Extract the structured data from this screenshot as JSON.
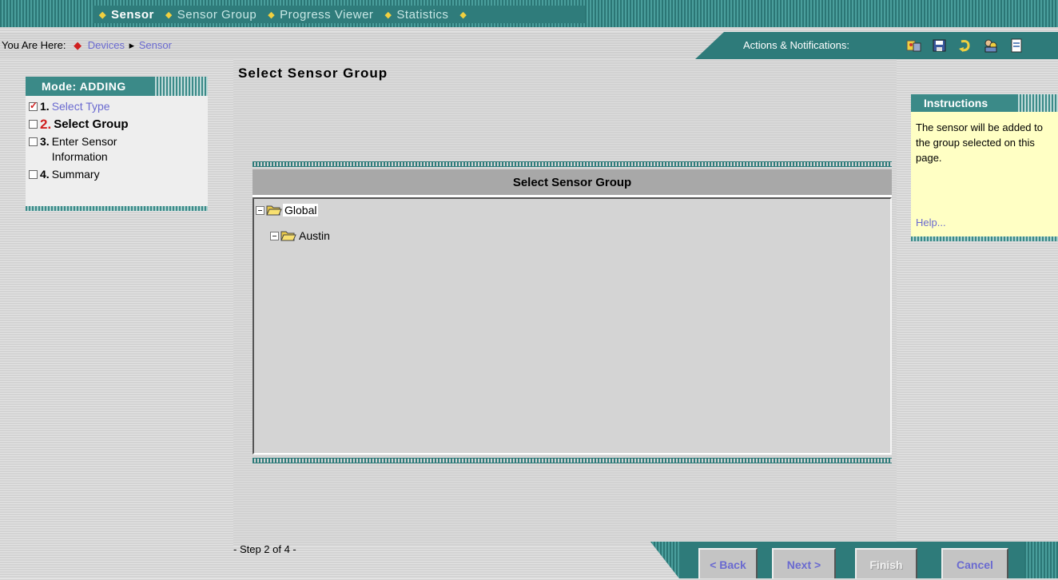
{
  "nav": {
    "tabs": [
      {
        "label": "Sensor",
        "active": true
      },
      {
        "label": "Sensor Group",
        "active": false
      },
      {
        "label": "Progress Viewer",
        "active": false
      },
      {
        "label": "Statistics",
        "active": false
      }
    ]
  },
  "breadcrumb": {
    "label": "You Are Here:",
    "items": [
      "Devices",
      "Sensor"
    ]
  },
  "actions": {
    "label": "Actions & Notifications:",
    "icons": [
      "tools-icon",
      "save-icon",
      "refresh-icon",
      "users-icon",
      "document-icon"
    ]
  },
  "wizard": {
    "mode": "Mode: ADDING",
    "steps": [
      {
        "num": "1.",
        "label": "Select Type",
        "state": "done"
      },
      {
        "num": "2.",
        "label": "Select Group",
        "state": "current"
      },
      {
        "num": "3.",
        "label": "Enter Sensor Information",
        "state": "pending"
      },
      {
        "num": "4.",
        "label": "Summary",
        "state": "pending"
      }
    ]
  },
  "page": {
    "title": "Select Sensor Group",
    "panel_title": "Select Sensor Group",
    "tree": [
      {
        "name": "Global",
        "level": 0,
        "selected": true
      },
      {
        "name": "Austin",
        "level": 1,
        "selected": false
      }
    ],
    "step_indicator": "- Step 2 of 4 -"
  },
  "instructions": {
    "title": "Instructions",
    "text": "The sensor will be added to the group selected on this page.",
    "help": "Help..."
  },
  "buttons": {
    "back": "< Back",
    "next": "Next >",
    "finish": "Finish",
    "cancel": "Cancel"
  },
  "colors": {
    "teal": "#2e7b7a",
    "link": "#6a6ad0",
    "accent": "#d02020",
    "instructions_bg": "#ffffc4"
  }
}
